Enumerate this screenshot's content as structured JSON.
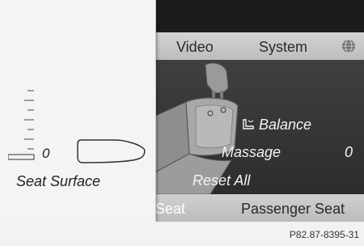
{
  "header": {
    "tabs": [
      {
        "label": "Video"
      },
      {
        "label": "System"
      }
    ]
  },
  "menu": {
    "balance_label": "Balance",
    "massage_label": "Massage",
    "massage_value": "0",
    "reset_label": "Reset All"
  },
  "footer": {
    "tabs": [
      {
        "label": "Seat"
      },
      {
        "label": "Passenger Seat"
      }
    ]
  },
  "seat_surface": {
    "label": "Seat Surface",
    "value": "0"
  },
  "caption": "P82.87-8395-31",
  "colors": {
    "screen_bg": "#2a2a2a",
    "bar_bg": "#c8c8c8",
    "panel_bg": "#f4f4f4",
    "text_light": "#f3f3f3"
  },
  "icons": {
    "tab_bar": "globe-icon",
    "balance": "seat-balance-icon"
  }
}
